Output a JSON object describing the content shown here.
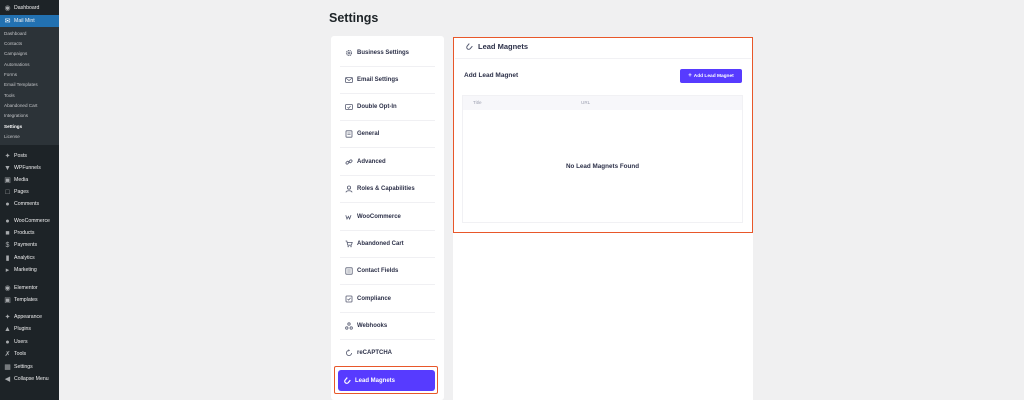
{
  "wp_menu": {
    "dashboard": "Dashboard",
    "mail_mint": "Mail Mint",
    "submenu": [
      "Dashboard",
      "Contacts",
      "Campaigns",
      "Automations",
      "Forms",
      "Email Templates",
      "Tools",
      "Abandoned Cart",
      "Integrations",
      "Settings",
      "License"
    ],
    "posts": "Posts",
    "wpfunnels": "WPFunnels",
    "media": "Media",
    "pages": "Pages",
    "comments": "Comments",
    "woocommerce": "WooCommerce",
    "products": "Products",
    "payments": "Payments",
    "analytics": "Analytics",
    "marketing": "Marketing",
    "elementor": "Elementor",
    "templates": "Templates",
    "appearance": "Appearance",
    "plugins": "Plugins",
    "users": "Users",
    "tools": "Tools",
    "settings": "Settings",
    "collapse": "Collapse Menu"
  },
  "page": {
    "title": "Settings"
  },
  "settings_nav": [
    {
      "label": "Business Settings",
      "icon": "gear-icon"
    },
    {
      "label": "Email Settings",
      "icon": "envelope-icon"
    },
    {
      "label": "Double Opt-In",
      "icon": "envelope-check-icon"
    },
    {
      "label": "General",
      "icon": "document-icon"
    },
    {
      "label": "Advanced",
      "icon": "link-icon"
    },
    {
      "label": "Roles & Capabilities",
      "icon": "user-icon"
    },
    {
      "label": "WooCommerce",
      "icon": "woo-icon"
    },
    {
      "label": "Abandoned Cart",
      "icon": "cart-icon"
    },
    {
      "label": "Contact Fields",
      "icon": "fields-icon"
    },
    {
      "label": "Compliance",
      "icon": "compliance-icon"
    },
    {
      "label": "Webhooks",
      "icon": "webhook-icon"
    },
    {
      "label": "reCAPTCHA",
      "icon": "recaptcha-icon"
    },
    {
      "label": "Lead Magnets",
      "icon": "magnet-icon",
      "active": true
    }
  ],
  "lead_magnets": {
    "title": "Lead Magnets",
    "add_heading": "Add Lead Magnet",
    "add_button": "Add Lead Magnet",
    "columns": [
      "Title",
      "URL"
    ],
    "empty": "No Lead Magnets Found"
  },
  "colors": {
    "accent": "#573bff",
    "highlight": "#e8572a",
    "wp_sidebar": "#1d2327",
    "wp_active": "#2271b1"
  }
}
